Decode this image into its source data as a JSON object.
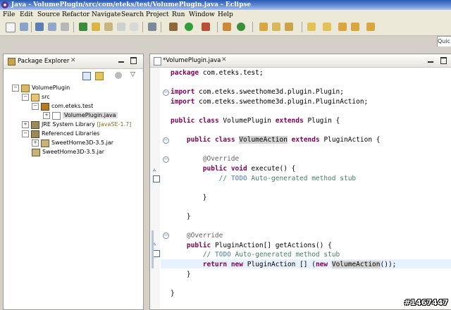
{
  "window": {
    "title": "Java - VolumePlugin/src/com/eteks/test/VolumePlugin.java - Eclipse"
  },
  "menu": [
    "File",
    "Edit",
    "Source",
    "Refactor",
    "Navigate",
    "Search",
    "Project",
    "Run",
    "Window",
    "Help"
  ],
  "quick_access": {
    "placeholder": "Quic"
  },
  "package_explorer": {
    "title": "Package Explorer",
    "tree": [
      {
        "label": "VolumePlugin",
        "icon": "project-icon",
        "expanded": true,
        "depth": 0
      },
      {
        "label": "src",
        "icon": "source-folder-icon",
        "expanded": true,
        "depth": 1
      },
      {
        "label": "com.eteks.test",
        "icon": "package-icon",
        "expanded": true,
        "depth": 2
      },
      {
        "label": "VolumePlugin.java",
        "icon": "java-file-icon",
        "expanded": false,
        "depth": 3,
        "selected": true
      },
      {
        "label": "JRE System Library",
        "decoration": "[JavaSE-1.7]",
        "icon": "library-icon",
        "expanded": false,
        "depth": 1
      },
      {
        "label": "Referenced Libraries",
        "icon": "library-icon",
        "expanded": true,
        "depth": 1
      },
      {
        "label": "SweetHome3D-3.5.jar",
        "icon": "jar-icon",
        "expanded": false,
        "depth": 2
      },
      {
        "label": "SweetHome3D-3.5.jar",
        "icon": "jar-icon",
        "expanded": false,
        "depth": 1
      }
    ]
  },
  "editor": {
    "tab_label": "*VolumePlugin.java",
    "lines": [
      "package com.eteks.test;",
      "",
      "import com.eteks.sweethome3d.plugin.Plugin;",
      "import com.eteks.sweethome3d.plugin.PluginAction;",
      "",
      "public class VolumePlugin extends Plugin {",
      "",
      "    public class VolumeAction extends PluginAction {",
      "",
      "        @Override",
      "        public void execute() {",
      "            // TODO Auto-generated method stub",
      "",
      "        }",
      "",
      "    }",
      "",
      "    @Override",
      "    public PluginAction[] getActions() {",
      "        // TODO Auto-generated method stub",
      "        return new PluginAction [] (new VolumeAction());",
      "    }",
      "",
      "}"
    ]
  },
  "watermark": "#1467447",
  "colors": {
    "keyword": "#7f0055",
    "comment": "#3f7f5f",
    "todo": "#7f9fbf",
    "annotation": "#646464",
    "current_line": "#e8f2fe"
  }
}
